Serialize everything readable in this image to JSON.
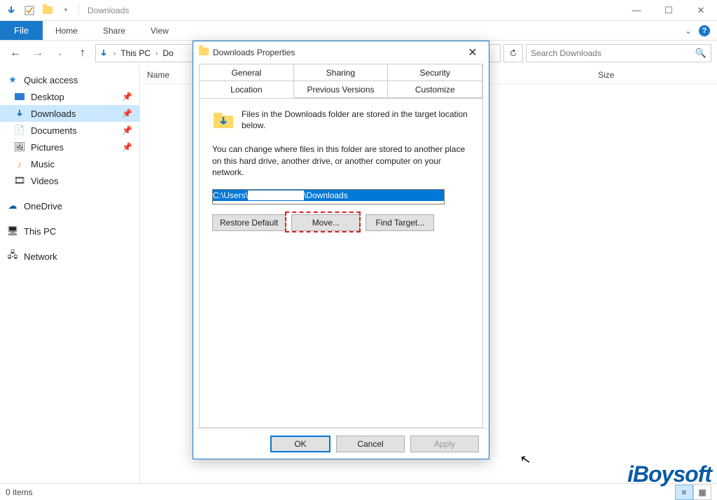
{
  "window": {
    "title": "Downloads",
    "minimize": "—",
    "maximize": "☐",
    "close": "✕"
  },
  "ribbon": {
    "file": "File",
    "tabs": [
      "Home",
      "Share",
      "View"
    ],
    "expand": "⌄"
  },
  "address": {
    "back": "←",
    "forward": "→",
    "up": "↑",
    "crumbs": [
      "This PC",
      "Do"
    ],
    "refresh": "↻",
    "search_placeholder": "Search Downloads"
  },
  "columns": {
    "name": "Name",
    "date": "",
    "size": "Size"
  },
  "sidebar": {
    "quick": "Quick access",
    "items": [
      {
        "label": "Desktop",
        "pin": true
      },
      {
        "label": "Downloads",
        "pin": true,
        "selected": true
      },
      {
        "label": "Documents",
        "pin": true
      },
      {
        "label": "Pictures",
        "pin": true
      },
      {
        "label": "Music",
        "pin": false
      },
      {
        "label": "Videos",
        "pin": false
      }
    ],
    "onedrive": "OneDrive",
    "thispc": "This PC",
    "network": "Network"
  },
  "status": {
    "items": "0 items"
  },
  "dialog": {
    "title": "Downloads Properties",
    "tabs_row1": [
      "General",
      "Sharing",
      "Security"
    ],
    "tabs_row2": [
      "Location",
      "Previous Versions",
      "Customize"
    ],
    "active_tab": "Location",
    "info1": "Files in the Downloads folder are stored in the target location below.",
    "info2": "You can change where files in this folder are stored to another place on this hard drive, another drive, or another computer on your network.",
    "path_part1": "C:\\Users\\",
    "path_part2": "\\Downloads",
    "restore": "Restore Default",
    "move": "Move...",
    "find": "Find Target...",
    "ok": "OK",
    "cancel": "Cancel",
    "apply": "Apply"
  },
  "watermark": "iBoysoft"
}
